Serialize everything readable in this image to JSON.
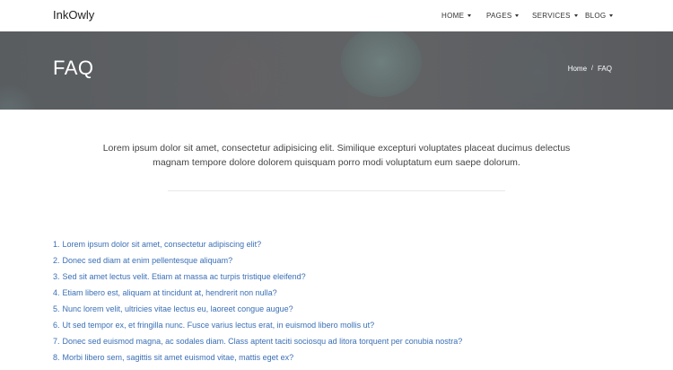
{
  "brand": "InkOwly",
  "nav": {
    "items": [
      {
        "label": "HOME"
      },
      {
        "label": "PAGES"
      },
      {
        "label": "SERVICES"
      },
      {
        "label": "BLOG"
      }
    ]
  },
  "hero": {
    "title": "FAQ",
    "breadcrumb": {
      "home": "Home",
      "separator": "/",
      "current": "FAQ"
    }
  },
  "intro": {
    "text": "Lorem ipsum dolor sit amet, consectetur adipisicing elit. Similique excepturi voluptates placeat ducimus delectus magnam tempore dolore dolorem quisquam porro modi voluptatum eum saepe dolorum."
  },
  "faq": {
    "questions": [
      {
        "num": "1.",
        "text": "Lorem ipsum dolor sit amet, consectetur adipiscing elit?"
      },
      {
        "num": "2.",
        "text": "Donec sed diam at enim pellentesque aliquam?"
      },
      {
        "num": "3.",
        "text": "Sed sit amet lectus velit. Etiam at massa ac turpis tristique eleifend?"
      },
      {
        "num": "4.",
        "text": "Etiam libero est, aliquam at tincidunt at, hendrerit non nulla?"
      },
      {
        "num": "5.",
        "text": "Nunc lorem velit, ultricies vitae lectus eu, laoreet congue augue?"
      },
      {
        "num": "6.",
        "text": "Ut sed tempor ex, et fringilla nunc. Fusce varius lectus erat, in euismod libero mollis ut?"
      },
      {
        "num": "7.",
        "text": "Donec sed euismod magna, ac sodales diam. Class aptent taciti sociosqu ad litora torquent per conubia nostra?"
      },
      {
        "num": "8.",
        "text": "Morbi libero sem, sagittis sit amet euismod vitae, mattis eget ex?"
      }
    ]
  },
  "colors": {
    "link": "#3a6fb5",
    "hero_bg": "#5e6063",
    "text": "#444444"
  }
}
